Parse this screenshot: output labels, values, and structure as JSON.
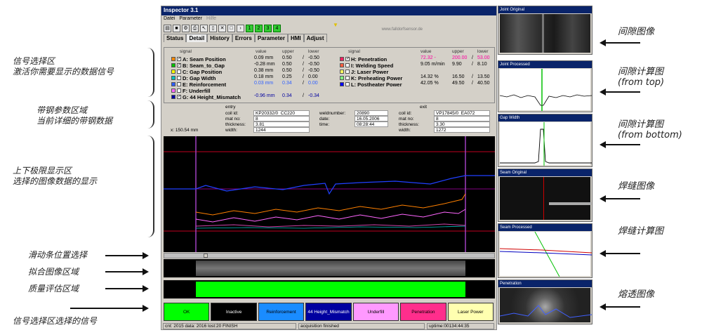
{
  "window": {
    "title": "Inspector 3.1",
    "menu": [
      "Datei",
      "Parameter",
      "Hilfe"
    ],
    "toolbar_numbers": [
      "1",
      "2",
      "3",
      "4"
    ],
    "brand": "www.falldorfsensor.de",
    "tabs": [
      "Status",
      "Detail",
      "History",
      "Errors",
      "Parameter",
      "HMI",
      "Adjust"
    ],
    "active_tab": "Detail"
  },
  "signals": {
    "headers": {
      "signal": "signal",
      "value": "value",
      "upper": "upper",
      "lower": "lower"
    },
    "left": [
      {
        "name": "A: Seam Position",
        "value": "0.09 mm",
        "upper": "0.50",
        "sep": "/",
        "lower": "-0.50",
        "color": "#ff8800",
        "checked": true
      },
      {
        "name": "B: Seam_to_Gap",
        "value": "-0.28 mm",
        "upper": "0.50",
        "sep": "/",
        "lower": "-0.50",
        "color": "#00c000",
        "checked": true
      },
      {
        "name": "C: Gap Position",
        "value": "0.38 mm",
        "upper": "0.50",
        "sep": "/",
        "lower": "-0.50",
        "color": "#ffff00",
        "checked": false
      },
      {
        "name": "D: Gap Width",
        "value": "0.18 mm",
        "upper": "0.25",
        "sep": "/",
        "lower": "0.00",
        "color": "#00c0c0",
        "checked": false
      },
      {
        "name": "E: Reinforcement",
        "value": "0.03 mm",
        "upper": "0.34",
        "sep": "/",
        "lower": "0.00",
        "color": "#3060ff",
        "checked": false
      },
      {
        "name": "F: Underfill",
        "value": "",
        "upper": "",
        "sep": "",
        "lower": "",
        "color": "#ff66ff",
        "checked": false
      },
      {
        "name": "G: 44 Height_Mismatch",
        "value": "-0.96 mm",
        "upper": "0.34",
        "sep": "/",
        "lower": "-0.34",
        "color": "#0000a0",
        "checked": true
      }
    ],
    "right": [
      {
        "name": "H: Penetration",
        "value": "72.32 -",
        "upper": "200.00",
        "sep": "/",
        "lower": "53.00",
        "color": "#ff2060",
        "checked": true
      },
      {
        "name": "I: Welding Speed",
        "value": "9.05 m/min",
        "upper": "9.90",
        "sep": "/",
        "lower": "8.10",
        "color": "#ff6040",
        "checked": false
      },
      {
        "name": "J: Laser Power",
        "value": "",
        "upper": "",
        "sep": "",
        "lower": "",
        "color": "#ffff60",
        "checked": false
      },
      {
        "name": "K: Preheating Power",
        "value": "14.32 %",
        "upper": "16.50",
        "sep": "/",
        "lower": "13.50",
        "color": "#80ff80",
        "checked": false
      },
      {
        "name": "L: Postheater Power",
        "value": "42.05 %",
        "upper": "49.50",
        "sep": "/",
        "lower": "40.50",
        "color": "#0000ff",
        "checked": false
      }
    ]
  },
  "info": {
    "entry_label": "entry",
    "exit_label": "exit",
    "coil_id_label": "coil id:",
    "entry_coil": "KP20332/0",
    "entry_coil2": "CC220",
    "mat_no_label": "mat no:",
    "entry_mat": "8",
    "thickness_label": "thickness:",
    "entry_thickness": "3.81",
    "width_label": "width:",
    "entry_width": "1244",
    "weld_label": "weldnumber:",
    "weld": "20890",
    "date_label": "date:",
    "date": "16.05.2006",
    "time_label": "time:",
    "time": "08:28:44",
    "exit_coil": "VP17845/0",
    "exit_coil2": "EA072",
    "exit_mat": "8",
    "exit_thickness": "3.30",
    "exit_width": "1272",
    "position": "x: 150.54 mm"
  },
  "signal_boxes": [
    {
      "label": "OK",
      "bg": "#00ff00",
      "fg": "#000"
    },
    {
      "label": "Inactive",
      "bg": "#000000",
      "fg": "#fff"
    },
    {
      "label": "Reinforcement",
      "bg": "#1a8cff",
      "fg": "#000"
    },
    {
      "label": "44 Height_Mismatch",
      "bg": "#0000a0",
      "fg": "#fff"
    },
    {
      "label": "Underfill",
      "bg": "#ff99ff",
      "fg": "#000"
    },
    {
      "label": "Penetration",
      "bg": "#ff2e8c",
      "fg": "#000"
    },
    {
      "label": "Laser Power",
      "bg": "#ffffb0",
      "fg": "#000"
    }
  ],
  "status": {
    "count": "cnt: 2015 data: 2016 lost:20 FINISH",
    "acq": "acquisition finished",
    "uptime": "uptime:00134:44:35"
  },
  "right_panels": [
    {
      "title": "Joint Original"
    },
    {
      "title": "Joint Processed"
    },
    {
      "title": "Gap Width"
    },
    {
      "title": "Seam Original"
    },
    {
      "title": "Seam Processed"
    },
    {
      "title": "Penetration"
    }
  ],
  "annotations_left": {
    "signal_select": "信号选择区",
    "signal_select_desc": "激活你需要显示的数据信号",
    "strip_params": "带钢参数区域",
    "strip_params_desc": "当前详细的带钢数据",
    "limits": "上下极限显示区",
    "limits_desc": "选择的图像数据的显示",
    "slider": "滑动条位置选择",
    "fit": "拟合图像区域",
    "quality": "质量评估区域",
    "selected_signals": "信号选择区选择的信号"
  },
  "annotations_right": {
    "gap_image": "间隙图像",
    "gap_calc_top": "间隙计算图",
    "from_top": "(from top)",
    "gap_calc_bottom": "间隙计算图",
    "from_bottom": "(from bottom)",
    "seam_image": "焊缝图像",
    "seam_calc": "焊缝计算图",
    "penetration_image": "熔透图像"
  }
}
